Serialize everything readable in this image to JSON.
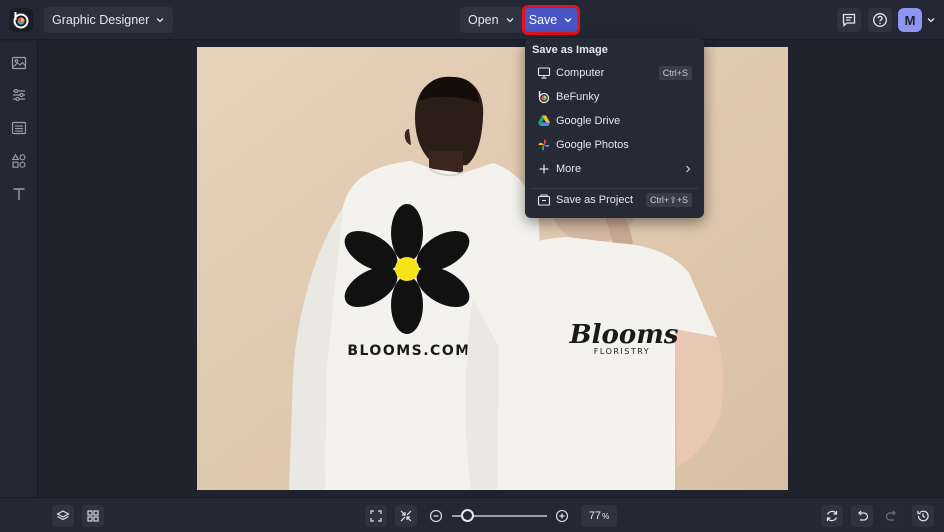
{
  "topbar": {
    "app_mode": "Graphic Designer",
    "open_label": "Open",
    "save_label": "Save",
    "avatar_initial": "M"
  },
  "save_menu": {
    "heading": "Save as Image",
    "items": [
      {
        "label": "Computer",
        "shortcut": "Ctrl+S",
        "icon": "computer-icon"
      },
      {
        "label": "BeFunky",
        "icon": "befunky-icon"
      },
      {
        "label": "Google Drive",
        "icon": "google-drive-icon"
      },
      {
        "label": "Google Photos",
        "icon": "google-photos-icon"
      },
      {
        "label": "More",
        "icon": "plus-icon"
      }
    ],
    "project": {
      "label": "Save as Project",
      "shortcut": "Ctrl+⇧+S",
      "icon": "project-icon"
    }
  },
  "canvas": {
    "shirt_text_left": "BLOOMS.COM",
    "shirt_logo_script": "Blooms",
    "shirt_logo_sub": "FLORISTRY"
  },
  "bottombar": {
    "zoom_value": "77",
    "zoom_unit": "%"
  },
  "colors": {
    "accent": "#4a55c4",
    "highlight": "#e0141b",
    "avatar": "#8f95f3",
    "background": "#20232d"
  }
}
